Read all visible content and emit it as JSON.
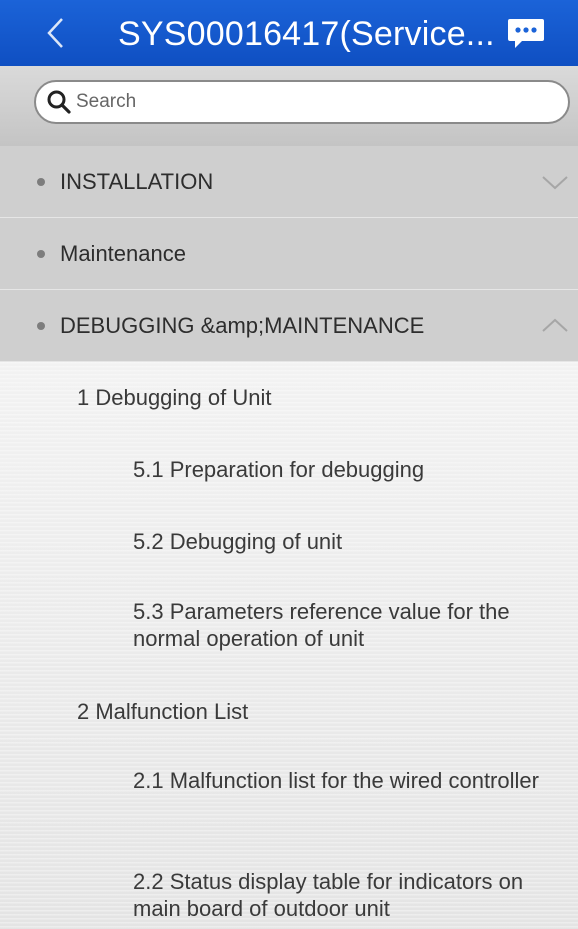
{
  "header": {
    "title": "SYS00016417(Service...",
    "back_icon": "chevron-left-icon",
    "chat_icon": "chat-bubble-icon"
  },
  "search": {
    "placeholder": "Search",
    "value": ""
  },
  "categories": [
    {
      "label": "INSTALLATION",
      "chevron": "chevron-down-icon"
    },
    {
      "label": "Maintenance"
    },
    {
      "label": "DEBUGGING &amp;MAINTENANCE",
      "chevron": "chevron-up-icon"
    }
  ],
  "debugging_items": [
    {
      "label": "1 Debugging of Unit",
      "level": 1
    },
    {
      "label": "5.1 Preparation for debugging",
      "level": 2
    },
    {
      "label": "5.2 Debugging of unit",
      "level": 2
    },
    {
      "label": "5.3 Parameters reference value for the normal operation of unit",
      "level": 2
    },
    {
      "label": "2 Malfunction List",
      "level": 1
    },
    {
      "label": "2.1 Malfunction list for the wired controller",
      "level": 2
    },
    {
      "label": "2.2 Status display table for indicators on main board of outdoor unit",
      "level": 2
    }
  ],
  "colors": {
    "header": "#1b63d8",
    "category_bg": "#cfcfcf",
    "content_bg": "#ececec"
  }
}
